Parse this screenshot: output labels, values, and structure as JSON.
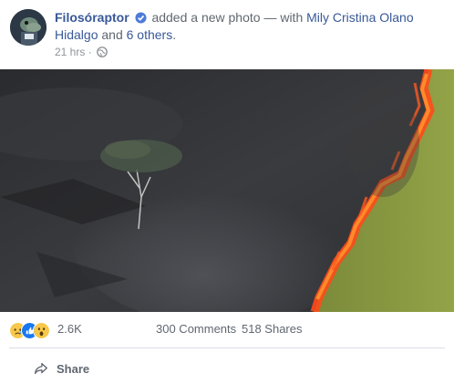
{
  "post": {
    "author": "Filosóraptor",
    "action_text": " added a new photo — with ",
    "tagged_person": "Mily Cristina Olano Hidalgo",
    "and_text": " and ",
    "others_text": "6 others",
    "period": ".",
    "timestamp": "21 hrs",
    "separator": " · ",
    "privacy_icon": "globe-icon"
  },
  "reactions": {
    "icons": [
      "sad-icon",
      "like-icon",
      "wow-icon"
    ],
    "count": "2.6K",
    "comments": "300 Comments",
    "shares": "518 Shares"
  },
  "actions": {
    "share_label": "Share",
    "share_icon": "share-arrow-icon"
  },
  "colors": {
    "link": "#385898",
    "meta": "#90949c",
    "like_blue": "#1877f2",
    "reaction_yellow": "#f7c84a"
  }
}
